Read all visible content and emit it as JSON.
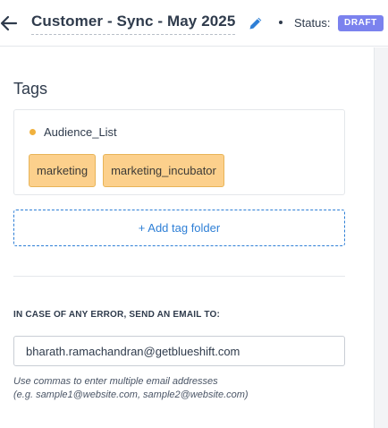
{
  "header": {
    "title": "Customer - Sync - May 2025",
    "status_label": "Status:",
    "status_value": "DRAFT"
  },
  "tags": {
    "section_title": "Tags",
    "folder_name": "Audience_List",
    "items": [
      "marketing",
      "marketing_incubator"
    ],
    "add_folder_label": "+ Add tag folder"
  },
  "error_email": {
    "label": "IN CASE OF ANY ERROR, SEND AN EMAIL TO:",
    "value": "bharath.ramachandran@getblueshift.com",
    "hint_line1": "Use commas to enter multiple email addresses",
    "hint_line2": "(e.g. sample1@website.com, sample2@website.com)"
  },
  "colors": {
    "accent": "#2e7fd6",
    "status_badge": "#7b82ee",
    "tag_chip": "#fcd08c",
    "folder_dot": "#f0b13d"
  },
  "icons": {
    "back": "arrow-left-icon",
    "edit": "pencil-icon"
  }
}
